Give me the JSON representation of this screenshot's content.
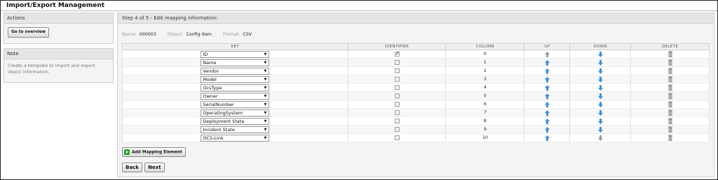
{
  "page": {
    "title": "Import/Export Management"
  },
  "sidebar": {
    "actions": {
      "title": "Actions",
      "overview_button": "Go to overview"
    },
    "note": {
      "title": "Note",
      "text": "Create a template to import and export object information."
    }
  },
  "main": {
    "step_title": "Step 4 of 5 - Edit mapping information:",
    "meta": {
      "name_label": "Name:",
      "name_value": "000003",
      "object_label": "Object:",
      "object_value": "Config Item",
      "format_label": "Format:",
      "format_value": "CSV"
    },
    "table": {
      "headers": {
        "key": "KEY",
        "identifier": "IDENTIFIER",
        "column": "COLUMN",
        "up": "UP",
        "down": "DOWN",
        "delete": "DELETE"
      },
      "rows": [
        {
          "key": "ID",
          "identifier": true,
          "column": "0",
          "up_enabled": false,
          "down_enabled": true
        },
        {
          "key": "Name",
          "identifier": false,
          "column": "1",
          "up_enabled": true,
          "down_enabled": true
        },
        {
          "key": "Vendor",
          "identifier": false,
          "column": "2",
          "up_enabled": true,
          "down_enabled": true
        },
        {
          "key": "Model",
          "identifier": false,
          "column": "3",
          "up_enabled": true,
          "down_enabled": true
        },
        {
          "key": "OcsType",
          "identifier": false,
          "column": "4",
          "up_enabled": true,
          "down_enabled": true
        },
        {
          "key": "Owner",
          "identifier": false,
          "column": "5",
          "up_enabled": true,
          "down_enabled": true
        },
        {
          "key": "SerialNumber",
          "identifier": false,
          "column": "6",
          "up_enabled": true,
          "down_enabled": true
        },
        {
          "key": "OperatingSystem",
          "identifier": false,
          "column": "7",
          "up_enabled": true,
          "down_enabled": true
        },
        {
          "key": "Deployment State",
          "identifier": false,
          "column": "8",
          "up_enabled": true,
          "down_enabled": true
        },
        {
          "key": "Incident State",
          "identifier": false,
          "column": "9",
          "up_enabled": true,
          "down_enabled": true
        },
        {
          "key": "OCS-Link",
          "identifier": false,
          "column": "10",
          "up_enabled": true,
          "down_enabled": false
        }
      ]
    },
    "add_button": "Add Mapping Element",
    "back_button": "Back",
    "next_button": "Next"
  },
  "colors": {
    "arrow_active": "#3d8fd6",
    "arrow_disabled": "#9a9a9a",
    "add_icon": "#2e9b2e",
    "trash": "#8c8c8c"
  }
}
